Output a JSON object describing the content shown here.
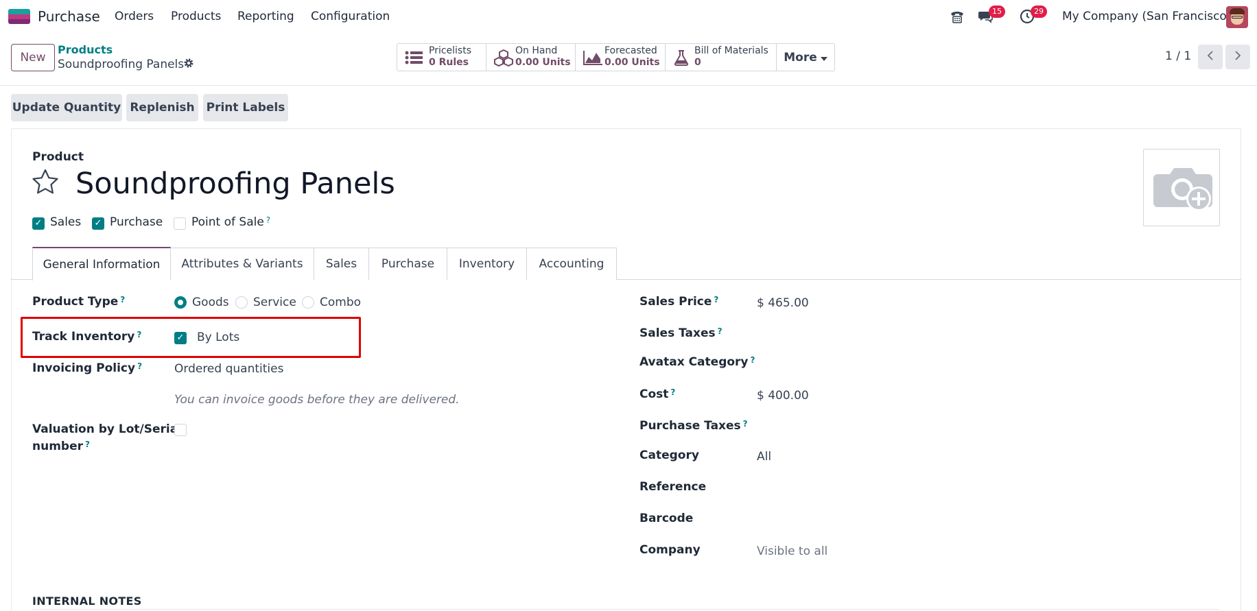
{
  "app": {
    "name": "Purchase",
    "menu": [
      "Orders",
      "Products",
      "Reporting",
      "Configuration"
    ]
  },
  "systray": {
    "messages_count": "15",
    "activities_count": "29",
    "company": "My Company (San Francisco)"
  },
  "control_panel": {
    "new_label": "New",
    "breadcrumb_parent": "Products",
    "breadcrumb_current": "Soundproofing Panels",
    "smart_buttons": [
      {
        "label": "Pricelists",
        "value": "0 Rules",
        "icon": "list-icon"
      },
      {
        "label": "On Hand",
        "value": "0.00 Units",
        "icon": "cubes-icon"
      },
      {
        "label": "Forecasted",
        "value": "0.00 Units",
        "icon": "area-chart-icon"
      },
      {
        "label": "Bill of Materials",
        "value": "0",
        "icon": "flask-icon"
      }
    ],
    "more_label": "More",
    "pager": "1 / 1"
  },
  "actions": [
    "Update Quantity",
    "Replenish",
    "Print Labels"
  ],
  "form": {
    "record_label": "Product",
    "name": "Soundproofing Panels",
    "flags": [
      {
        "label": "Sales",
        "checked": true
      },
      {
        "label": "Purchase",
        "checked": true
      },
      {
        "label": "Point of Sale",
        "checked": false
      }
    ],
    "tabs": [
      "General Information",
      "Attributes & Variants",
      "Sales",
      "Purchase",
      "Inventory",
      "Accounting"
    ],
    "left": {
      "product_type_label": "Product Type",
      "product_type_options": [
        "Goods",
        "Service",
        "Combo"
      ],
      "track_inventory_label": "Track Inventory",
      "track_inventory_value": "By Lots",
      "invoicing_policy_label": "Invoicing Policy",
      "invoicing_policy_value": "Ordered quantities",
      "invoicing_help": "You can invoice goods before they are delivered.",
      "valuation_label_1": "Valuation by Lot/Serial",
      "valuation_label_2": "number"
    },
    "right": {
      "sales_price_label": "Sales Price",
      "sales_price_value": "$ 465.00",
      "sales_taxes_label": "Sales Taxes",
      "avatax_label": "Avatax Category",
      "cost_label": "Cost",
      "cost_value": "$ 400.00",
      "purchase_taxes_label": "Purchase Taxes",
      "category_label": "Category",
      "category_value": "All",
      "reference_label": "Reference",
      "barcode_label": "Barcode",
      "company_label": "Company",
      "company_value": "Visible to all"
    },
    "internal_notes_label": "INTERNAL NOTES"
  },
  "colors": {
    "brand": "#714b67",
    "accent": "#017e84",
    "badge": "#e11d48",
    "highlight": "#e00000"
  }
}
